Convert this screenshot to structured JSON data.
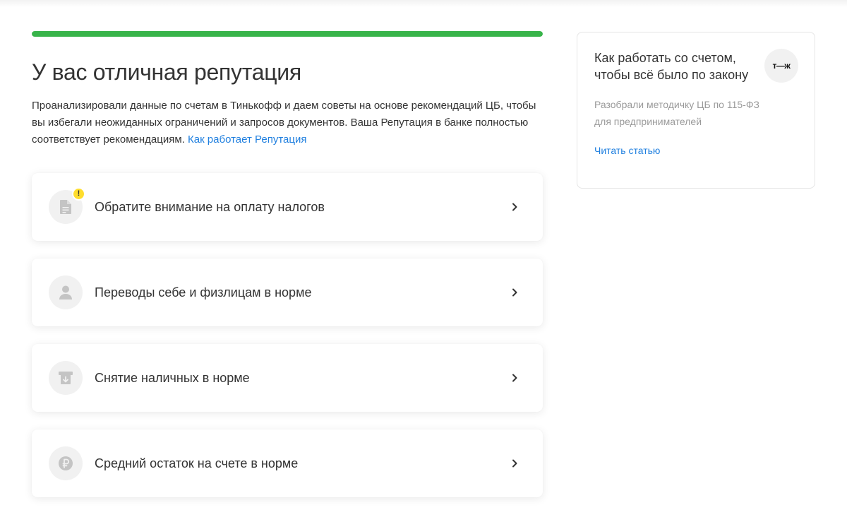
{
  "progress": {
    "value_percent": 100,
    "color": "#38b44a"
  },
  "header": {
    "title": "У вас отличная репутация",
    "description": "Проанализировали данные по счетам в Тинькофф и даем советы на основе рекомендаций ЦБ, чтобы вы избегали неожиданных ограничений и запросов документов. Ваша Репутация в банке полностью соответствует рекомендациям.",
    "link_label": "Как работает Репутация"
  },
  "cards": [
    {
      "label": "Обратите внимание на оплату налогов",
      "icon": "document-icon",
      "warning": "!"
    },
    {
      "label": "Переводы себе и физлицам в норме",
      "icon": "person-icon"
    },
    {
      "label": "Снятие наличных в норме",
      "icon": "cash-withdrawal-icon"
    },
    {
      "label": "Средний остаток на счете в норме",
      "icon": "ruble-icon"
    }
  ],
  "sidebar": {
    "title": "Как работать со счетом, чтобы всё было по закону",
    "logo_text": "т—ж",
    "description": "Разобрали методичку ЦБ по 115-ФЗ для предпринимателей",
    "link_label": "Читать статью"
  },
  "colors": {
    "accent": "#38b44a",
    "link": "#1f7fdf",
    "warning": "#ffdd2d"
  }
}
